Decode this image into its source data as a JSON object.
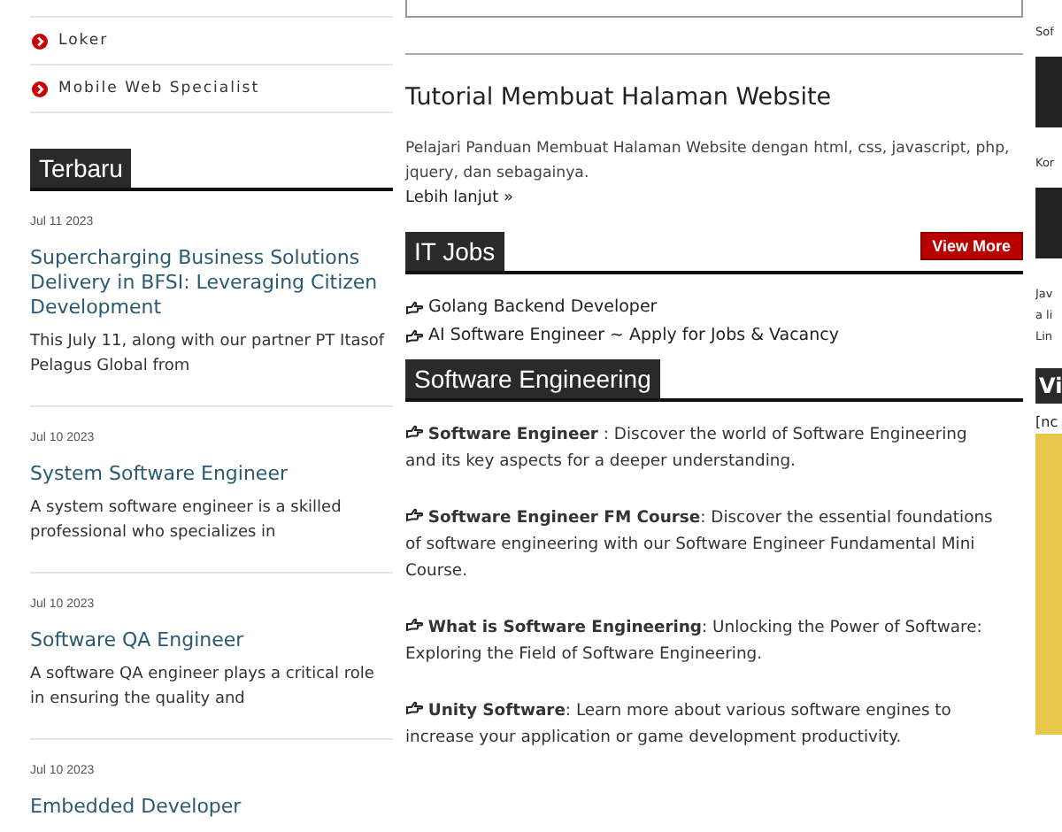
{
  "category_list": [
    {
      "label": "Loker"
    },
    {
      "label": "Mobile Web Specialist"
    }
  ],
  "latest": {
    "heading": "Terbaru",
    "posts": [
      {
        "date": "Jul 11 2023",
        "title": "Supercharging Business Solutions Delivery in BFSI: Leveraging Citizen Development",
        "excerpt": "This July 11, along with our partner PT Itasof Pelagus Global from"
      },
      {
        "date": "Jul 10 2023",
        "title": "System Software Engineer",
        "excerpt": "A system software engineer is a skilled professional who specializes in"
      },
      {
        "date": "Jul 10 2023",
        "title": "Software QA Engineer",
        "excerpt": "A software QA engineer plays a critical role in ensuring the quality and"
      },
      {
        "date": "Jul 10 2023",
        "title": "Embedded Developer"
      }
    ]
  },
  "tutorial": {
    "title": "Tutorial Membuat Halaman Website",
    "description": "Pelajari Panduan Membuat Halaman Website dengan html, css, javascript, php, jquery, dan sebagainya.",
    "link": "Lebih lanjut »"
  },
  "it_jobs": {
    "heading": "IT Jobs",
    "button": "View More",
    "items": [
      "Golang Backend Developer",
      "AI Software Engineer ~ Apply for Jobs & Vacancy"
    ]
  },
  "software_engineering": {
    "heading": "Software Engineering",
    "items": [
      "**Software Engineer** : Discover the world of Software Engineering and its key aspects for a deeper understanding.",
      "**Software Engineer FM Course**: Discover the essential foundations of software engineering with our Software Engineer Fundamental Mini Course.",
      "**What is Software Engineering**: Unlocking the Power of Software: Exploring the Field of Software Engineering.",
      "**Unity Software**: Learn more about various software engines to increase your application or game development productivity."
    ]
  },
  "right_sidebar": {
    "items": [
      "Sof",
      "Kor",
      "Jav\na li\nLin"
    ],
    "heading": "Vi",
    "note": "[nc"
  }
}
